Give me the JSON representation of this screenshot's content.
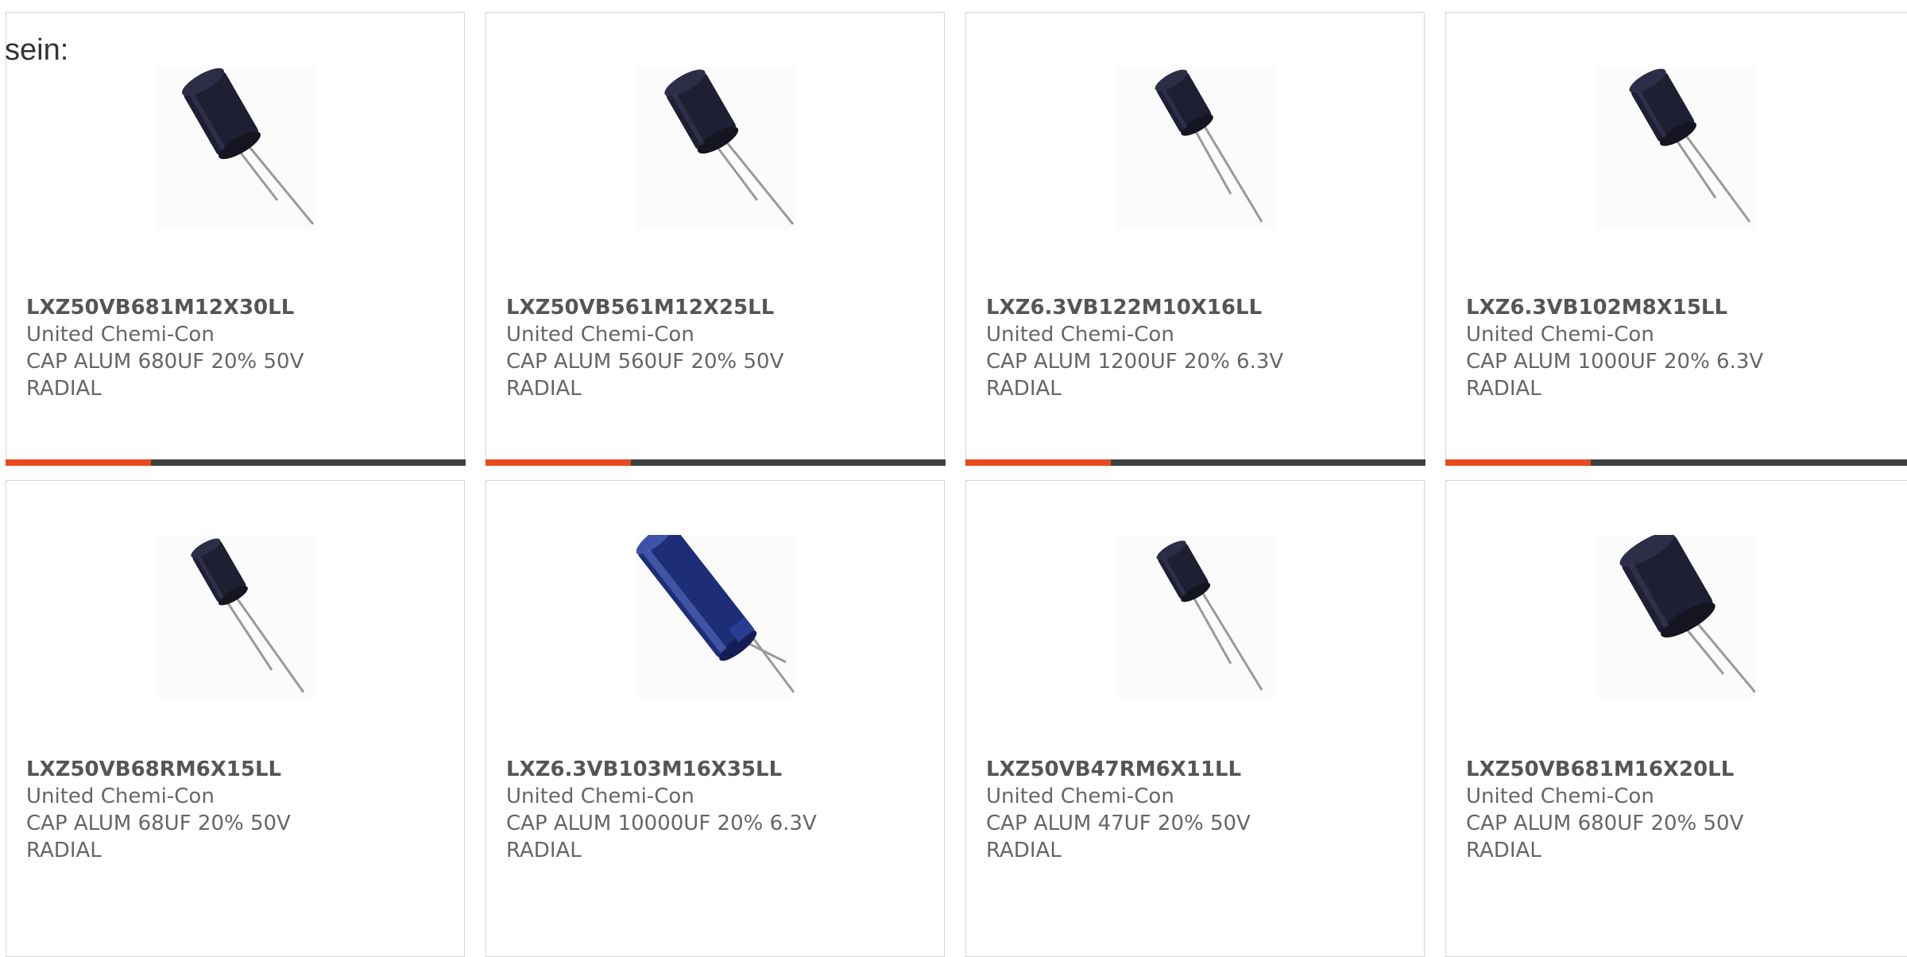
{
  "intro_text": "sein:",
  "accent_color": "#e8491d",
  "products": [
    {
      "part_number": "LXZ50VB681M12X30LL",
      "manufacturer": "United Chemi-Con",
      "description": "CAP ALUM 680UF 20% 50V",
      "package": "RADIAL",
      "image_icon": "radial-capacitor-icon"
    },
    {
      "part_number": "LXZ50VB561M12X25LL",
      "manufacturer": "United Chemi-Con",
      "description": "CAP ALUM 560UF 20% 50V",
      "package": "RADIAL",
      "image_icon": "radial-capacitor-icon"
    },
    {
      "part_number": "LXZ6.3VB122M10X16LL",
      "manufacturer": "United Chemi-Con",
      "description": "CAP ALUM 1200UF 20% 6.3V",
      "package": "RADIAL",
      "image_icon": "radial-capacitor-icon"
    },
    {
      "part_number": "LXZ6.3VB102M8X15LL",
      "manufacturer": "United Chemi-Con",
      "description": "CAP ALUM 1000UF 20% 6.3V",
      "package": "RADIAL",
      "image_icon": "radial-capacitor-icon"
    },
    {
      "part_number": "LXZ50VB68RM6X15LL",
      "manufacturer": "United Chemi-Con",
      "description": "CAP ALUM 68UF 20% 50V",
      "package": "RADIAL",
      "image_icon": "radial-capacitor-icon"
    },
    {
      "part_number": "LXZ6.3VB103M16X35LL",
      "manufacturer": "United Chemi-Con",
      "description": "CAP ALUM 10000UF 20% 6.3V",
      "package": "RADIAL",
      "image_icon": "radial-capacitor-blue-icon"
    },
    {
      "part_number": "LXZ50VB47RM6X11LL",
      "manufacturer": "United Chemi-Con",
      "description": "CAP ALUM 47UF 20% 50V",
      "package": "RADIAL",
      "image_icon": "radial-capacitor-icon"
    },
    {
      "part_number": "LXZ50VB681M16X20LL",
      "manufacturer": "United Chemi-Con",
      "description": "CAP ALUM 680UF 20% 50V",
      "package": "RADIAL",
      "image_icon": "radial-capacitor-icon"
    }
  ]
}
